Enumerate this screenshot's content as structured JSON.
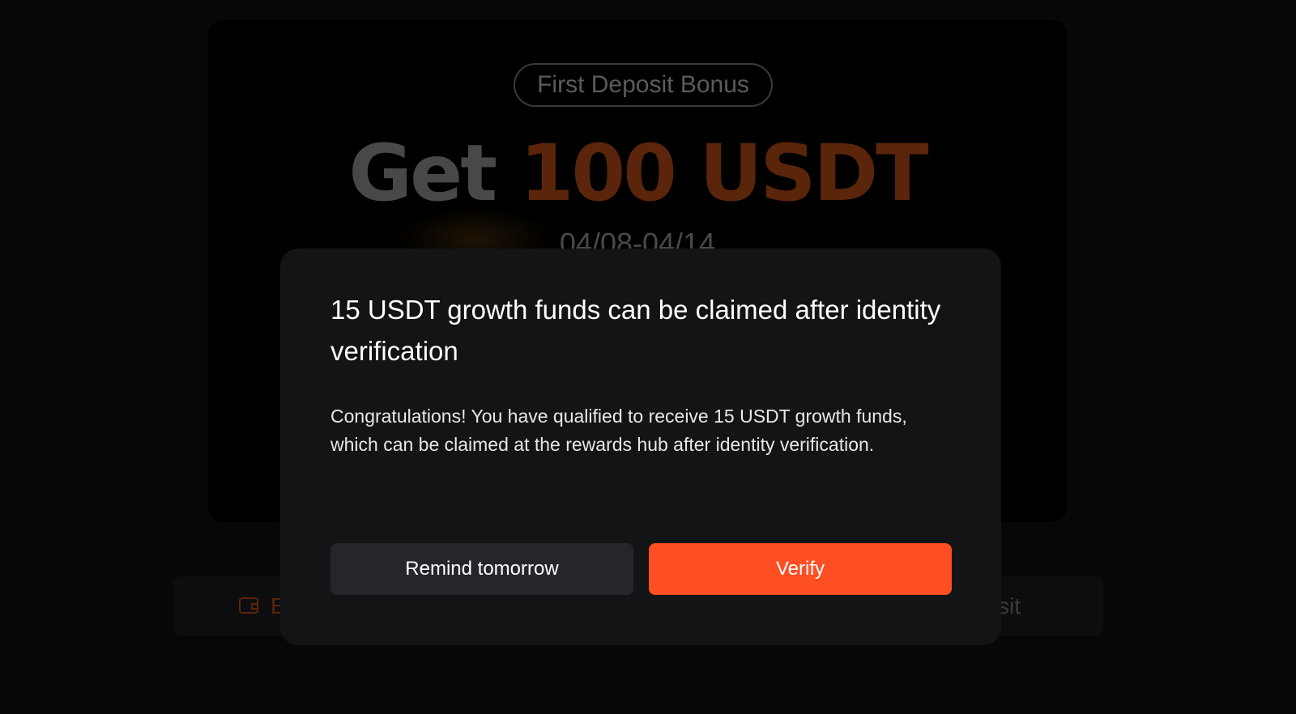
{
  "promo": {
    "badge": "First Deposit Bonus",
    "headline_get": "Get",
    "headline_amount": "100 USDT",
    "dates": "04/08-04/14"
  },
  "action_bar": {
    "left_label": "E",
    "right_label": "sit",
    "left_icon": "wallet-icon"
  },
  "modal": {
    "title": "15 USDT growth funds can be claimed after identity verification",
    "body": "Congratulations! You have qualified to receive 15 USDT growth funds, which can be claimed at the rewards hub after identity verification.",
    "secondary_button": "Remind tomorrow",
    "primary_button": "Verify"
  },
  "colors": {
    "accent": "#ff4e22",
    "modal_bg": "#131416",
    "secondary_button_bg": "#24262b",
    "page_bg": "#0a0b0d"
  }
}
